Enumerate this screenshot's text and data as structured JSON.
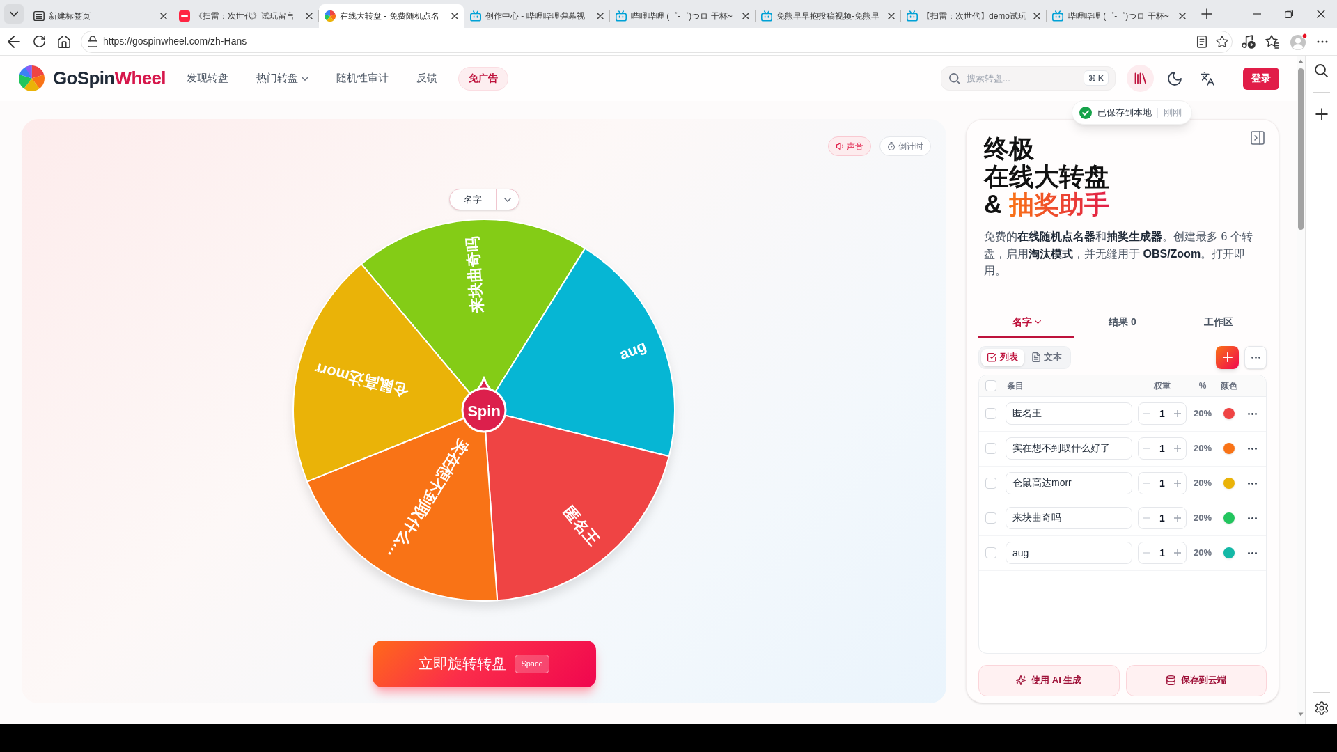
{
  "browser": {
    "tabs": [
      {
        "title": "新建标签页",
        "kind": "newtab",
        "selected": false
      },
      {
        "title": "《扫雷：次世代》试玩留言",
        "kind": "square",
        "selected": false
      },
      {
        "title": "在线大转盘 - 免费随机点名",
        "kind": "wheel",
        "selected": true
      },
      {
        "title": "创作中心 - 哔哩哔哩弹幕视",
        "kind": "tv",
        "selected": false
      },
      {
        "title": "哔哩哔哩 (゜-゜)つロ 干杯~",
        "kind": "tv",
        "selected": false
      },
      {
        "title": "免熊早早抱投稿视频-免熊早",
        "kind": "tv",
        "selected": false
      },
      {
        "title": "【扫雷：次世代】demo试玩",
        "kind": "tv",
        "selected": false
      },
      {
        "title": "哔哩哔哩 (゜-゜)つロ 干杯~",
        "kind": "tv",
        "selected": false
      }
    ],
    "address": "https://gospinwheel.com/zh-Hans"
  },
  "header": {
    "brand": {
      "text": "GoSpin",
      "accent": "Wheel"
    },
    "nav": [
      {
        "label": "发现转盘",
        "kind": "link"
      },
      {
        "label": "热门转盘",
        "kind": "dropdown"
      },
      {
        "label": "随机性审计",
        "kind": "link"
      },
      {
        "label": "反馈",
        "kind": "link"
      },
      {
        "label": "免广告",
        "kind": "pill"
      }
    ],
    "search": {
      "placeholder": "搜索转盘...",
      "shortcut": "⌘ K"
    },
    "login": "登录"
  },
  "toast": {
    "text": "已保存到本地",
    "time": "刚刚"
  },
  "wheel_panel": {
    "toggles": [
      {
        "label": "声音",
        "kind": "sound",
        "on": true
      },
      {
        "label": "倒计时",
        "kind": "timer",
        "on": false
      }
    ],
    "list_select": {
      "value": "名字"
    },
    "wheel": {
      "hub": "Spin",
      "segments": [
        {
          "label": "来块曲奇吗",
          "color": "#84cc16"
        },
        {
          "label": "aug",
          "color": "#06b6d4"
        },
        {
          "label": "匿名王",
          "color": "#ef4444"
        },
        {
          "label": "实在想不到取什么…",
          "color": "#f97316"
        },
        {
          "label": "仓鼠高达morr",
          "color": "#eab308"
        }
      ]
    },
    "spin_button": {
      "label": "立即旋转转盘",
      "shortcut": "Space"
    }
  },
  "side_panel": {
    "title": {
      "lines": [
        "终极",
        "在线大转盘"
      ],
      "prefix": "&",
      "highlight": "抽奖助手"
    },
    "description": "免费的**在线随机点名器**和**抽奖生成器**。创建最多 6 个转盘，启用**淘汰模式**，并无缝用于 **OBS/Zoom**。打开即用。",
    "tabs": [
      {
        "label": "名字",
        "selected": true,
        "dropdown": true
      },
      {
        "label": "结果 0",
        "selected": false,
        "dropdown": false
      },
      {
        "label": "工作区",
        "selected": false,
        "dropdown": false
      }
    ],
    "view_toggle": [
      {
        "label": "列表",
        "kind": "list",
        "selected": true
      },
      {
        "label": "文本",
        "kind": "text",
        "selected": false
      }
    ],
    "table": {
      "columns": [
        "条目",
        "权重",
        "%",
        "颜色"
      ],
      "all_checked": false,
      "rows": [
        {
          "checked": false,
          "name": "匿名王",
          "weight": "1",
          "percent": "20%",
          "color": "#ef4444"
        },
        {
          "checked": false,
          "name": "实在想不到取什么好了",
          "weight": "1",
          "percent": "20%",
          "color": "#f97316"
        },
        {
          "checked": false,
          "name": "仓鼠高达morr",
          "weight": "1",
          "percent": "20%",
          "color": "#eab308"
        },
        {
          "checked": false,
          "name": "来块曲奇吗",
          "weight": "1",
          "percent": "20%",
          "color": "#22c55e"
        },
        {
          "checked": false,
          "name": "aug",
          "weight": "1",
          "percent": "20%",
          "color": "#14b8a6"
        }
      ]
    },
    "actions": [
      {
        "label": "使用 AI 生成",
        "kind": "ai"
      },
      {
        "label": "保存到云端",
        "kind": "cloud"
      }
    ]
  }
}
